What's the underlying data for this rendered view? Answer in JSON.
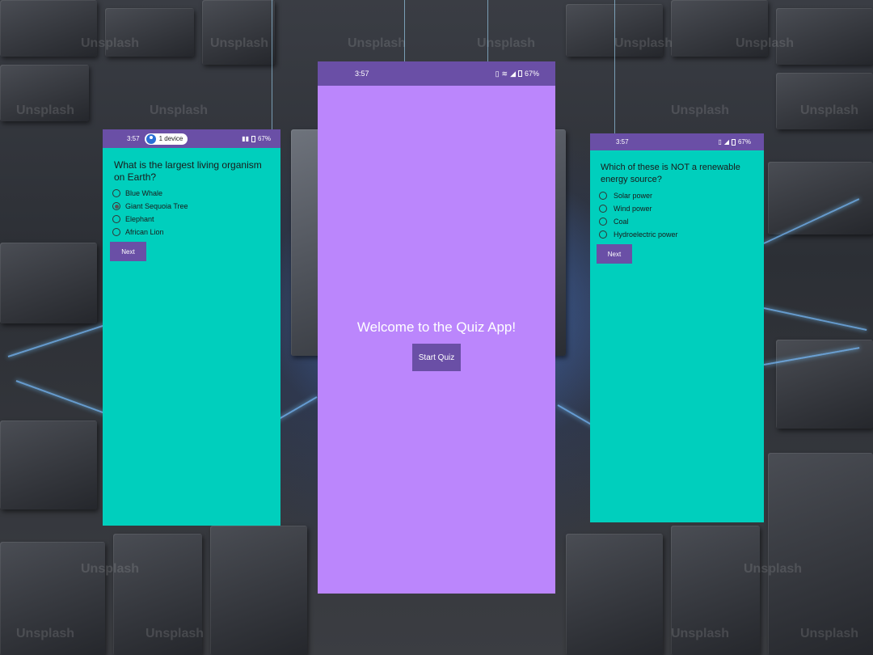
{
  "background": {
    "watermark": "Unsplash"
  },
  "left_screen": {
    "status": {
      "time": "3:57",
      "chip_label": "1 device",
      "battery": "67%"
    },
    "question": "What is the largest living organism on Earth?",
    "options": [
      "Blue Whale",
      "Giant Sequoia Tree",
      "Elephant",
      "African Lion"
    ],
    "selected_index": 1,
    "next_label": "Next"
  },
  "center_screen": {
    "status": {
      "time": "3:57",
      "battery": "67%"
    },
    "welcome": "Welcome to the Quiz App!",
    "start_label": "Start Quiz"
  },
  "right_screen": {
    "status": {
      "time": "3:57",
      "battery": "67%"
    },
    "question": "Which of these is NOT a renewable energy source?",
    "options": [
      "Solar power",
      "Wind power",
      "Coal",
      "Hydroelectric power"
    ],
    "selected_index": -1,
    "next_label": "Next"
  },
  "colors": {
    "status_bar": "#6a4fa6",
    "quiz_bg": "#00cfbd",
    "welcome_bg": "#bb86fc",
    "button": "#6a4fa6"
  }
}
